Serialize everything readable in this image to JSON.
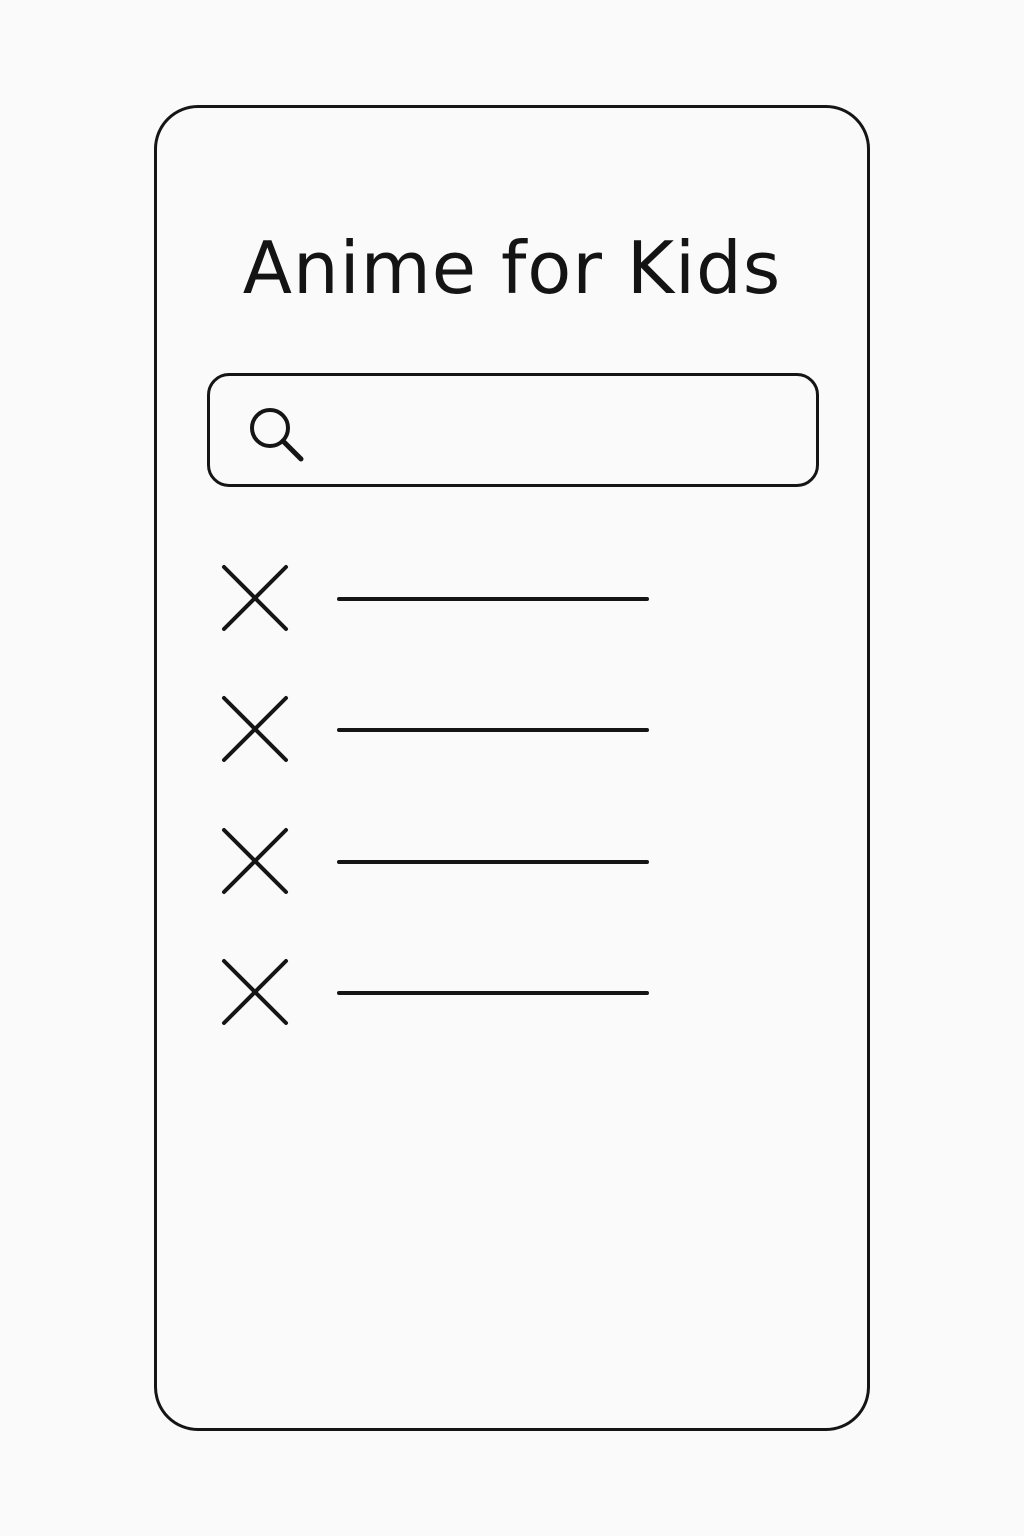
{
  "app": {
    "title": "Anime for Kids"
  },
  "search": {
    "placeholder": "",
    "value": "",
    "icon": "search-icon"
  },
  "list": {
    "items": [
      {
        "icon": "close-icon",
        "label": ""
      },
      {
        "icon": "close-icon",
        "label": ""
      },
      {
        "icon": "close-icon",
        "label": ""
      },
      {
        "icon": "close-icon",
        "label": ""
      }
    ]
  },
  "colors": {
    "background": "#fafafa",
    "stroke": "#151515"
  }
}
